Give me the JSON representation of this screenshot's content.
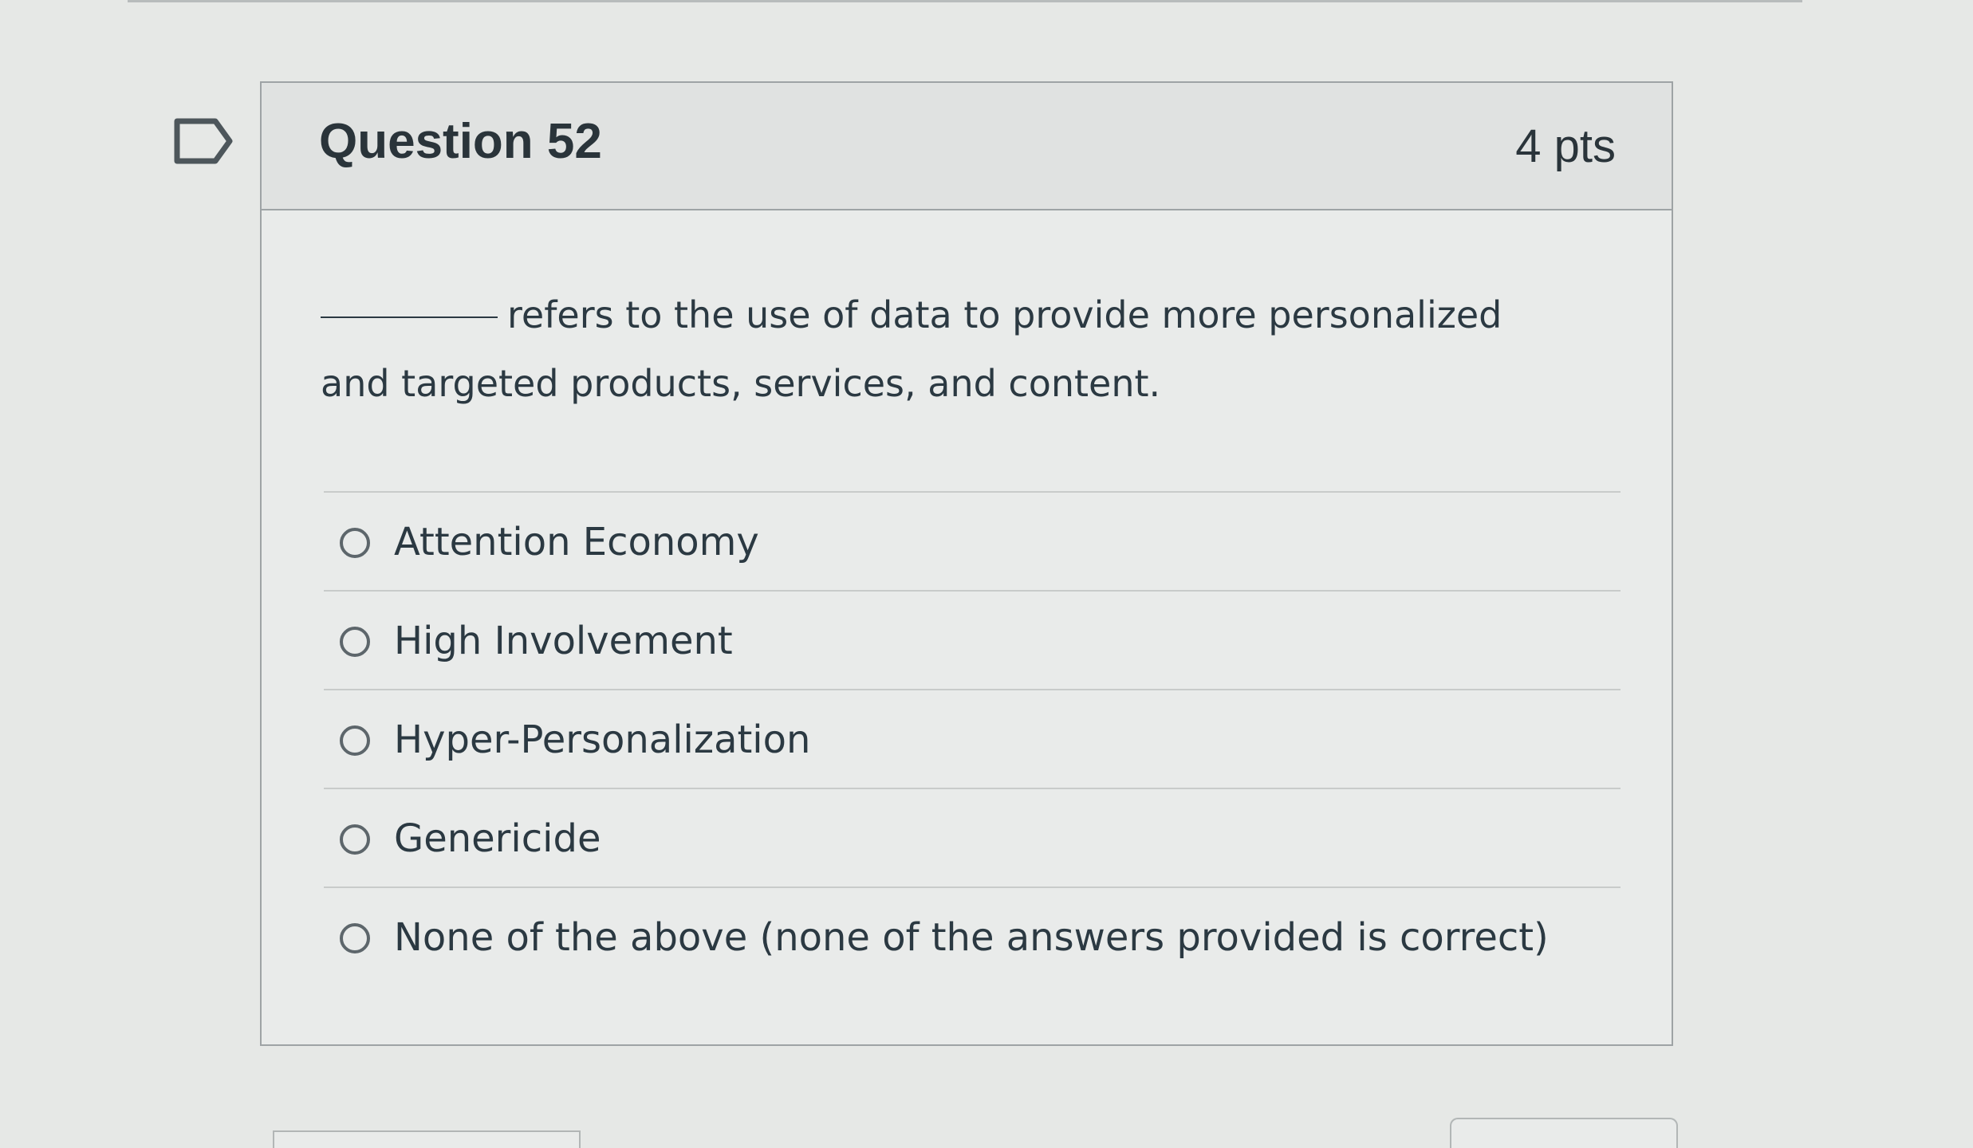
{
  "question": {
    "title": "Question 52",
    "points": "4 pts",
    "flag_icon": "flag-outline-icon",
    "text": "refers to the use of data to provide more personalized and targeted products, services, and content."
  },
  "answers": [
    {
      "label": "Attention Economy",
      "selected": false
    },
    {
      "label": "High Involvement",
      "selected": false
    },
    {
      "label": "Hyper-Personalization",
      "selected": false
    },
    {
      "label": "Genericide",
      "selected": false
    },
    {
      "label": "None of the above (none of the answers provided is correct)",
      "selected": false
    }
  ],
  "colors": {
    "background": "#e6e8e6",
    "card": "#e9ebea",
    "border": "#9ea3a5",
    "text": "#2b3942"
  }
}
